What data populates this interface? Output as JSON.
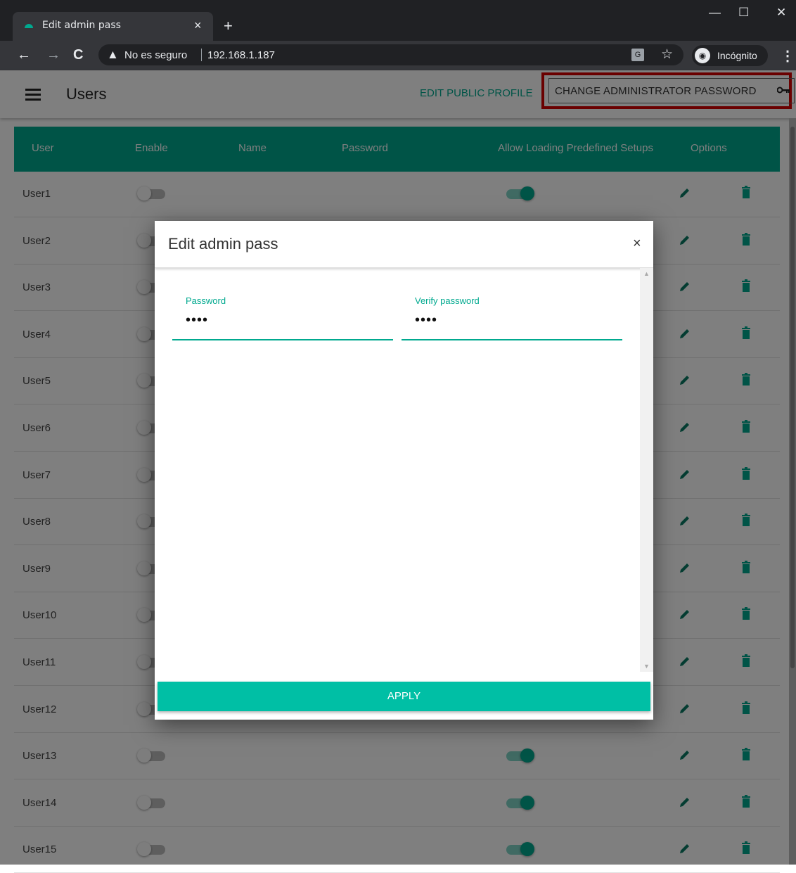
{
  "browser": {
    "tab_title": "Edit admin pass",
    "tab_close": "×",
    "new_tab": "+",
    "window_controls": [
      "—",
      "☐",
      "✕"
    ],
    "nav": {
      "back": "←",
      "forward": "→",
      "reload": "C"
    },
    "security_warning": "No es seguro",
    "url": "192.168.1.187",
    "translate_icon": "translate-icon",
    "star_icon": "☆",
    "incognito_label": "Incógnito",
    "menu": "⋮"
  },
  "header": {
    "title": "Users",
    "edit_public_profile": "EDIT PUBLIC PROFILE",
    "change_admin_password": "CHANGE ADMINISTRATOR PASSWORD"
  },
  "table": {
    "columns": [
      "User",
      "Enable",
      "Name",
      "Password",
      "Allow Loading Predefined Setups",
      "Options"
    ],
    "rows": [
      {
        "user": "User1",
        "enable": false,
        "allow_loading": true
      },
      {
        "user": "User2",
        "enable": false,
        "allow_loading": true
      },
      {
        "user": "User3",
        "enable": false,
        "allow_loading": true
      },
      {
        "user": "User4",
        "enable": false,
        "allow_loading": true
      },
      {
        "user": "User5",
        "enable": false,
        "allow_loading": true
      },
      {
        "user": "User6",
        "enable": false,
        "allow_loading": true
      },
      {
        "user": "User7",
        "enable": false,
        "allow_loading": true
      },
      {
        "user": "User8",
        "enable": false,
        "allow_loading": true
      },
      {
        "user": "User9",
        "enable": false,
        "allow_loading": true
      },
      {
        "user": "User10",
        "enable": false,
        "allow_loading": true
      },
      {
        "user": "User11",
        "enable": false,
        "allow_loading": true
      },
      {
        "user": "User12",
        "enable": false,
        "allow_loading": true
      },
      {
        "user": "User13",
        "enable": false,
        "allow_loading": true
      },
      {
        "user": "User14",
        "enable": false,
        "allow_loading": true
      },
      {
        "user": "User15",
        "enable": false,
        "allow_loading": true
      }
    ]
  },
  "modal": {
    "title": "Edit admin pass",
    "close": "×",
    "password_label": "Password",
    "password_value": "••••",
    "verify_label": "Verify password",
    "verify_value": "••••",
    "apply_label": "APPLY"
  },
  "colors": {
    "accent": "#00a98f",
    "apply": "#00bfa5",
    "highlight": "#d50000"
  }
}
